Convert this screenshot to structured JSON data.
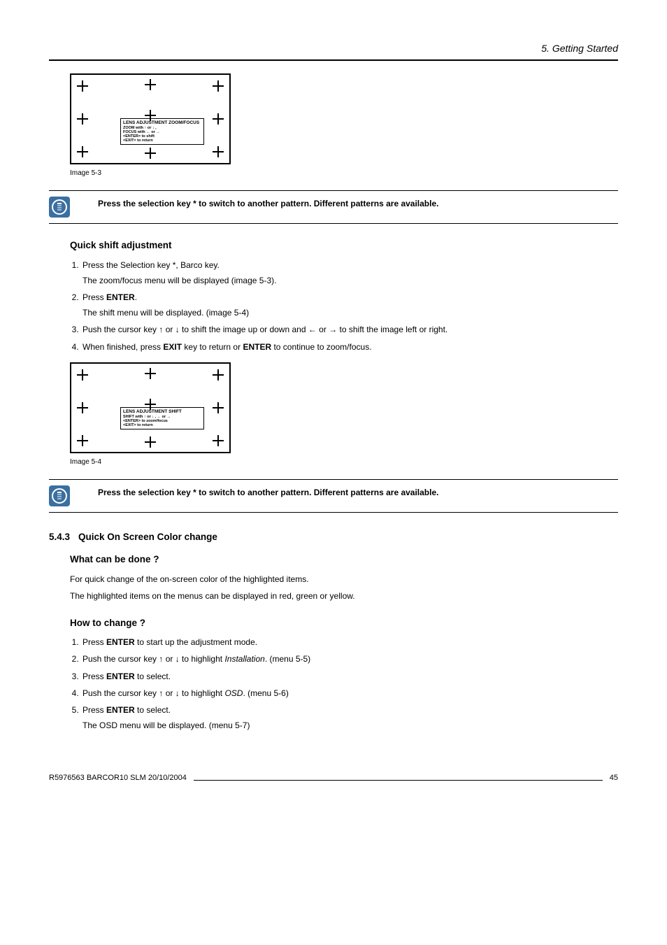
{
  "chapter": "5.  Getting Started",
  "figures": {
    "f53": {
      "caption": "Image 5-3",
      "menu": {
        "title": "LENS ADJUSTMENT ZOOM/FOCUS",
        "lines": [
          "ZOOM with ↑ or ↓ ,",
          "FOCUS with ← or →",
          "<ENTER> to shift",
          "<EXIT> to return"
        ]
      }
    },
    "f54": {
      "caption": "Image 5-4",
      "menu": {
        "title": "LENS ADJUSTMENT SHIFT",
        "lines": [
          "SHIFT with ↑ or ↓ , ← or →",
          "<ENTER> to zoom/focus",
          "<EXIT> to return"
        ]
      }
    }
  },
  "notes": {
    "pattern": "Press the selection key * to switch to another pattern. Different patterns are available."
  },
  "quickShift": {
    "heading": "Quick shift adjustment",
    "steps": {
      "s1a": "Press the Selection key *, Barco key.",
      "s1b": "The zoom/focus menu will be displayed (image 5-3).",
      "s2pre": "Press ",
      "s2bold": "ENTER",
      "s2post": ".",
      "s2b": "The shift menu will be displayed. (image 5-4)",
      "s3": "Push the cursor key ↑ or ↓ to shift the image up or down and ← or → to shift the image left or right.",
      "s4pre": "When finished, press ",
      "s4b1": "EXIT",
      "s4mid": " key to return or ",
      "s4b2": "ENTER",
      "s4post": " to continue to zoom/focus."
    }
  },
  "section543": {
    "num": "5.4.3",
    "title": "Quick On Screen Color change",
    "what": {
      "heading": "What can be done ?",
      "p1": "For quick change of the on-screen color of the highlighted items.",
      "p2": "The highlighted items on the menus can be displayed in red, green or yellow."
    },
    "how": {
      "heading": "How to change ?",
      "s1pre": "Press ",
      "s1b": "ENTER",
      "s1post": " to start up the adjustment mode.",
      "s2pre": "Push the cursor key ↑ or ↓ to highlight ",
      "s2i": "Installation",
      "s2post": ". (menu 5-5)",
      "s3pre": "Press ",
      "s3b": "ENTER",
      "s3post": " to select.",
      "s4pre": "Push the cursor key ↑ or ↓ to highlight ",
      "s4i": "OSD",
      "s4post": ". (menu 5-6)",
      "s5pre": "Press ",
      "s5b": "ENTER",
      "s5post": " to select.",
      "s5after": "The OSD menu will be displayed. (menu 5-7)"
    }
  },
  "footer": {
    "left": "R5976563  BARCOR10 SLM  20/10/2004",
    "page": "45"
  }
}
